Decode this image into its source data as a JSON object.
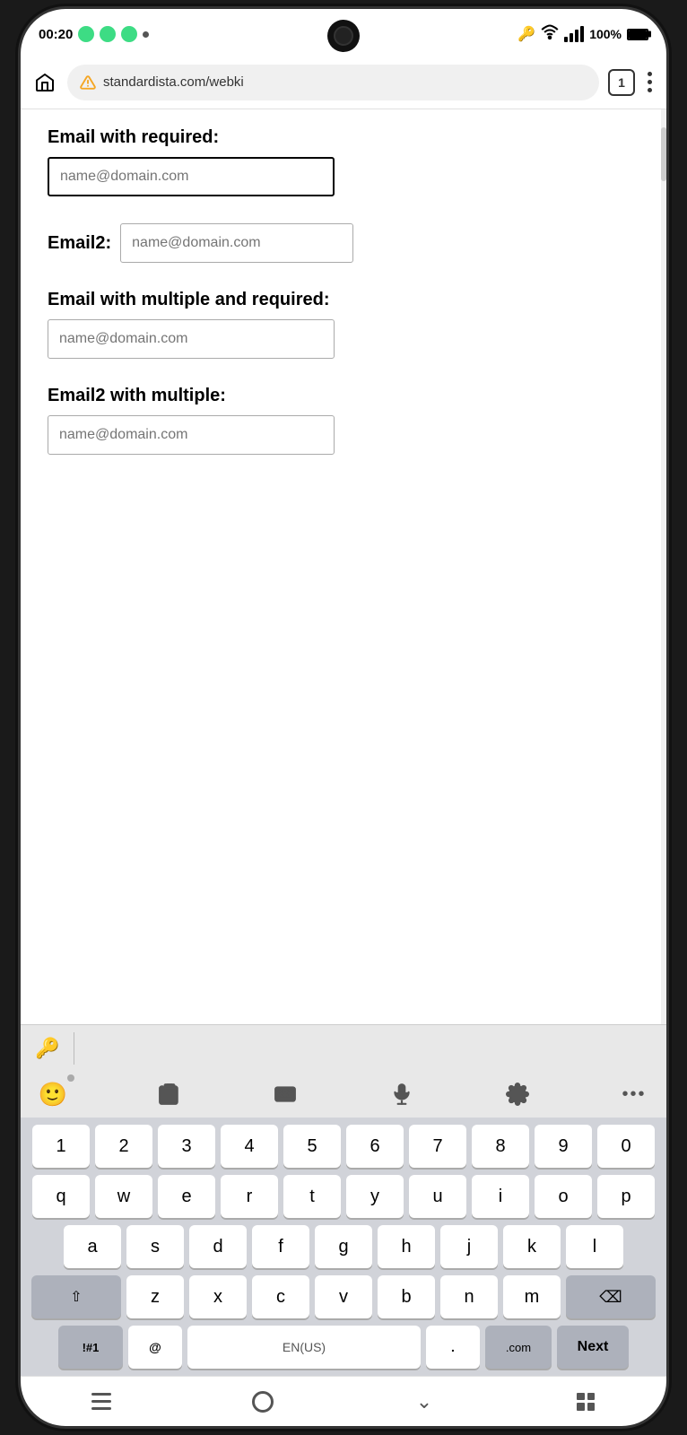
{
  "statusBar": {
    "time": "00:20",
    "batteryPercent": "100%",
    "dotLabel": "•"
  },
  "browserBar": {
    "url": "standardista.com/webki",
    "tabCount": "1"
  },
  "form": {
    "field1": {
      "label": "Email with required:",
      "placeholder": "name@domain.com",
      "borderStyle": "thick"
    },
    "field2": {
      "label": "Email2:",
      "placeholder": "name@domain.com",
      "borderStyle": "thin"
    },
    "field3": {
      "label": "Email with multiple and required:",
      "placeholder": "name@domain.com",
      "borderStyle": "thin"
    },
    "field4": {
      "label": "Email2 with multiple:",
      "placeholder": "name@domain.com",
      "borderStyle": "thin"
    }
  },
  "keyboard": {
    "row0": [
      "1",
      "2",
      "3",
      "4",
      "5",
      "6",
      "7",
      "8",
      "9",
      "0"
    ],
    "row1": [
      "q",
      "w",
      "e",
      "r",
      "t",
      "y",
      "u",
      "i",
      "o",
      "p"
    ],
    "row2": [
      "a",
      "s",
      "d",
      "f",
      "g",
      "h",
      "j",
      "k",
      "l"
    ],
    "row3": [
      "z",
      "x",
      "c",
      "v",
      "b",
      "n",
      "m"
    ],
    "specialLeft": "!#1",
    "at": "@",
    "spacebar": "EN(US)",
    "dot": ".",
    "dotCom": ".com",
    "next": "Next",
    "backspace": "⌫"
  },
  "emojiToolbar": {
    "emojiLabel": "🙂",
    "clipboardLabel": "clipboard",
    "keyboardLabel": "keyboard",
    "micLabel": "mic",
    "settingsLabel": "settings",
    "moreLabel": "..."
  },
  "keyIcon": "🔑"
}
